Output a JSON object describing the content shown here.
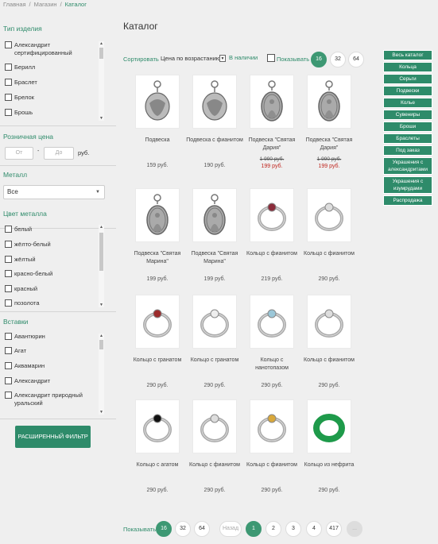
{
  "breadcrumb": [
    "Главная",
    "Магазин",
    "Каталог"
  ],
  "sidebar": {
    "type": {
      "title": "Тип изделия",
      "items": [
        "Александрит сертифицированный",
        "Берилл",
        "Браслет",
        "Брелок",
        "Брошь"
      ]
    },
    "price": {
      "title": "Розничная цена",
      "from_placeholder": "От",
      "dash": "-",
      "to_placeholder": "До",
      "currency": "руб."
    },
    "metal": {
      "title": "Металл",
      "value": "Все"
    },
    "color": {
      "title": "Цвет металла",
      "items": [
        "белый",
        "жёлто-белый",
        "жёлтый",
        "красно-белый",
        "красный",
        "позолота"
      ]
    },
    "inserts": {
      "title": "Вставки",
      "items": [
        "Авантюрин",
        "Агат",
        "Аквамарин",
        "Александрит",
        "Александрит природный уральский"
      ]
    },
    "filter_button": "РАСШИРЕННЫЙ ФИЛЬТР"
  },
  "page_title": "Каталог",
  "sort": {
    "label": "Сортировать",
    "value": "Цена по возрастанию",
    "in_stock": "В наличии",
    "show_label": "Показывать",
    "per_page": [
      "16",
      "32",
      "64"
    ],
    "active": "16"
  },
  "products": [
    {
      "name": "Подвеска",
      "price": "159 руб.",
      "icon": "pendant-icon"
    },
    {
      "name": "Подвеска с фианитом",
      "price": "190 руб.",
      "icon": "pendant-icon"
    },
    {
      "name": "Подвеска \"Святая Дария\"",
      "old_price": "1 990 руб.",
      "price": "199 руб.",
      "sale": true,
      "icon": "medallion-icon"
    },
    {
      "name": "Подвеска \"Святая Дария\"",
      "old_price": "1 990 руб.",
      "price": "199 руб.",
      "sale": true,
      "icon": "medallion-icon"
    },
    {
      "name": "Подвеска \"Святая Марина\"",
      "price": "199 руб.",
      "icon": "medallion-icon"
    },
    {
      "name": "Подвеска \"Святая Марина\"",
      "price": "199 руб.",
      "icon": "medallion-icon"
    },
    {
      "name": "Кольцо с фианитом",
      "price": "219 руб.",
      "icon": "ring-icon"
    },
    {
      "name": "Кольцо с фианитом",
      "price": "290 руб.",
      "icon": "ring-icon"
    },
    {
      "name": "Кольцо с гранатом",
      "price": "290 руб.",
      "icon": "ring-icon"
    },
    {
      "name": "Кольцо с гранатом",
      "price": "290 руб.",
      "icon": "ring-icon"
    },
    {
      "name": "Кольцо с нанотопазом",
      "price": "290 руб.",
      "icon": "ring-icon"
    },
    {
      "name": "Кольцо с фианитом",
      "price": "290 руб.",
      "icon": "ring-icon"
    },
    {
      "name": "Кольцо с агатом",
      "price": "290 руб.",
      "icon": "ring-icon"
    },
    {
      "name": "Кольцо с фианитом",
      "price": "290 руб.",
      "icon": "ring-icon"
    },
    {
      "name": "Кольцо с фианитом",
      "price": "290 руб.",
      "icon": "ring-icon"
    },
    {
      "name": "Кольцо из нефрита",
      "price": "290 руб.",
      "icon": "ring-icon"
    }
  ],
  "categories": [
    "Весь каталог",
    "Кольца",
    "Серьги",
    "Подвески",
    "Колье",
    "Сувениры",
    "Броши",
    "Браслеты",
    "Под заказ",
    "Украшения с александритами",
    "Украшения с изумрудами",
    "Распродажа"
  ],
  "pagination": {
    "show_label": "Показывать",
    "per_page": [
      "16",
      "32",
      "64"
    ],
    "active": "16",
    "prev": "Назад",
    "pages": [
      "1",
      "2",
      "3",
      "4",
      "417"
    ],
    "current": "1",
    "next": "..."
  },
  "colors": {
    "accent": "#2e8b6a",
    "sale": "#c0271f"
  }
}
